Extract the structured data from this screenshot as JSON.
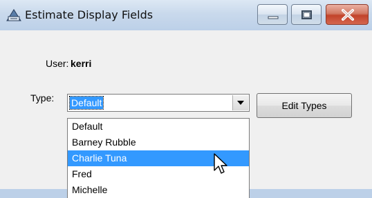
{
  "window": {
    "title": "Estimate Display Fields",
    "icon": "app-icon",
    "controls": {
      "minimize": "minimize-icon",
      "maximize": "maximize-icon",
      "close": "close-icon"
    }
  },
  "form": {
    "user_label": "User:",
    "user_value": "kerri",
    "type_label": "Type:",
    "type_selected": "Default",
    "edit_types_label": "Edit Types"
  },
  "dropdown": {
    "options": [
      "Default",
      "Barney Rubble",
      "Charlie Tuna",
      "Fred",
      "Michelle"
    ],
    "highlighted": "Charlie Tuna"
  },
  "colors": {
    "selection": "#3399ff",
    "title_bar": "#c9d9ec",
    "close_button": "#c2432a"
  }
}
